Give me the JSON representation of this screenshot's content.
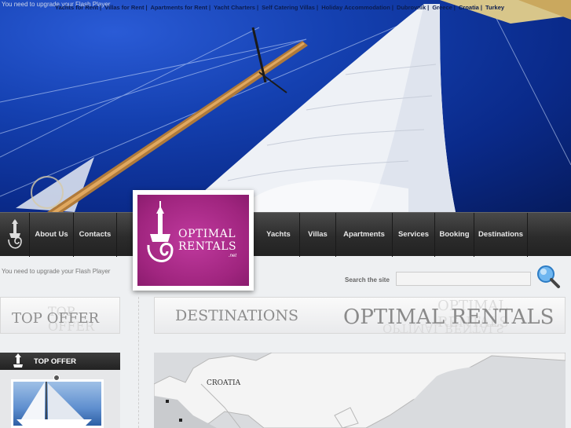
{
  "header": {
    "flash_notice": "You need to upgrade your Flash Player",
    "top_links": [
      "Yachts for Rent",
      "Villas for Rent",
      "Apartments for Rent",
      "Yacht Charters",
      "Self Catering Villas",
      "Holiday Accommodation",
      "Dubrovnik",
      "Greece",
      "Croatia",
      "Turkey"
    ]
  },
  "nav": {
    "items": [
      "About Us",
      "Contacts",
      "Yachts",
      "Villas",
      "Apartments",
      "Services",
      "Booking",
      "Destinations"
    ]
  },
  "logo": {
    "line1": "OPTIMAL",
    "line2": "RENTALS",
    "line3": ".net"
  },
  "search": {
    "label": "Search the site",
    "placeholder": ""
  },
  "left_banner": {
    "title": "TOP OFFER",
    "shadow": "TOP OFFER"
  },
  "main_banner": {
    "title": "DESTINATIONS",
    "brand": "OPTIMAL RENTALS",
    "brand_reflect": "OPTIMAL RENTALS"
  },
  "top_offer": {
    "label": "TOP OFFER"
  },
  "map": {
    "label": "CROATIA"
  },
  "colors": {
    "brand_magenta": "#a0257f",
    "nav_dark": "#2c2c2c",
    "sky_blue": "#1440b0"
  }
}
